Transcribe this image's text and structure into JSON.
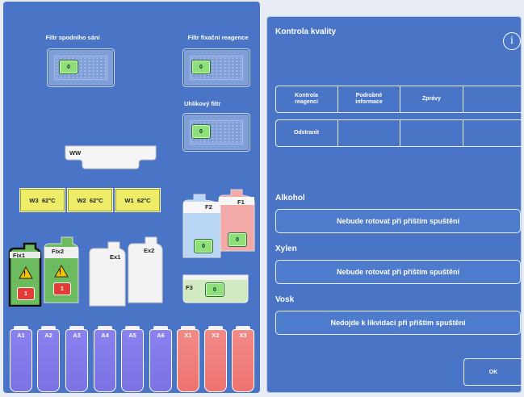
{
  "filters": {
    "lower_suction": {
      "label": "Filtr spodního sání",
      "value": "0"
    },
    "fixative_reagent": {
      "label": "Filtr fixační reagence",
      "value": "0"
    },
    "carbon": {
      "label": "Uhlíkový filtr",
      "value": "0"
    }
  },
  "waste_tray": {
    "label": "WW"
  },
  "wax_baths": [
    {
      "name": "W3",
      "temp": "62°C"
    },
    {
      "name": "W2",
      "temp": "62°C"
    },
    {
      "name": "W1",
      "temp": "62°C"
    }
  ],
  "fixative_containers": [
    {
      "name": "Fix1",
      "warning": "!",
      "value": "1"
    },
    {
      "name": "Fix2",
      "warning": "!",
      "value": "1"
    }
  ],
  "external": [
    {
      "name": "Ex1"
    },
    {
      "name": "Ex2"
    }
  ],
  "flasks": {
    "F2": {
      "name": "F2",
      "value": "0"
    },
    "F1": {
      "name": "F1",
      "value": "0"
    },
    "F3": {
      "name": "F3",
      "value": "0"
    }
  },
  "bottles": [
    {
      "name": "A1"
    },
    {
      "name": "A2"
    },
    {
      "name": "A3"
    },
    {
      "name": "A4"
    },
    {
      "name": "A5"
    },
    {
      "name": "A6"
    },
    {
      "name": "X1"
    },
    {
      "name": "X2"
    },
    {
      "name": "X3"
    }
  ],
  "panel": {
    "title": "Kontrola kvality",
    "info_icon": "i",
    "tabs_row1": [
      "Kontrola\nreagencí",
      "Podrobné\ninformace",
      "Zprávy",
      ""
    ],
    "tabs_row2": [
      "Odstranit",
      "",
      "",
      ""
    ],
    "sections": [
      {
        "title": "Alkohol",
        "button": "Nebude rotovat při příštím spuštění"
      },
      {
        "title": "Xylen",
        "button": "Nebude rotovat při příštím spuštění"
      },
      {
        "title": "Vosk",
        "button": "Nedojde k likvidaci při příštím spuštění"
      }
    ],
    "ok_label": "OK"
  },
  "colors": {
    "panel_blue": "#4a74c6",
    "alcohol": "#8b83f0",
    "xylene": "#f07b78",
    "wax_yellow": "#eded6a",
    "chip_green": "#8fe07a",
    "chip_red": "#e33b35"
  }
}
